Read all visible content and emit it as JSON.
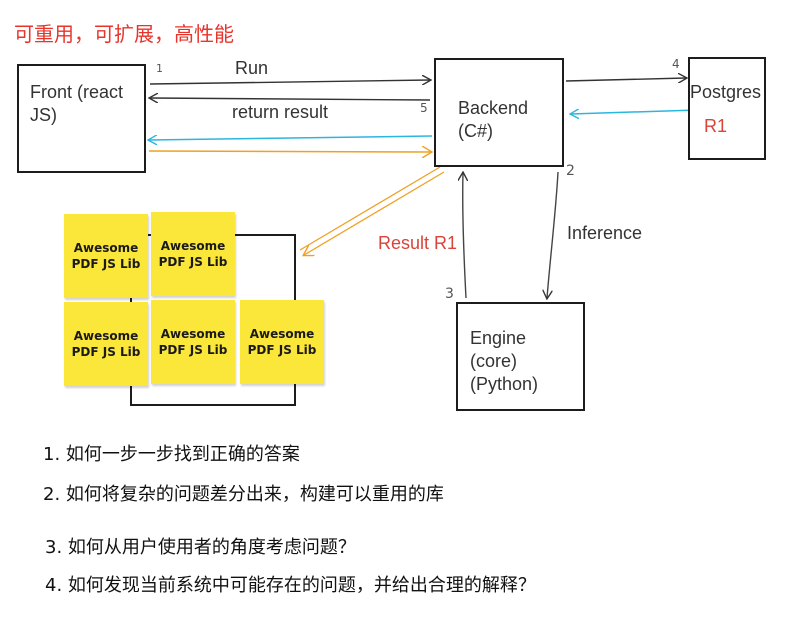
{
  "title": "可重用，可扩展，高性能",
  "nodes": {
    "front": "Front (react\nJS)",
    "backend": "Backend\n(C#)",
    "postgres": "Postgres",
    "postgres_r1": "R1",
    "engine": "Engine\n(core)\n(Python)"
  },
  "edges": {
    "run": "Run",
    "return_result": "return result",
    "inference": "Inference",
    "result_r1": "Result R1"
  },
  "step_marks": {
    "one": "1",
    "two": "2",
    "three": "3",
    "four": "4",
    "five": "5"
  },
  "libs": [
    "Awesome\nPDF JS Lib",
    "Awesome\nPDF JS Lib",
    "Awesome\nPDF JS Lib",
    "Awesome\nPDF JS Lib",
    "Awesome\nPDF JS Lib"
  ],
  "questions": [
    "1. 如何一步一步找到正确的答案",
    "2. 如何将复杂的问题差分出来，构建可以重用的库",
    "3. 如何从用户使用者的角度考虑问题？",
    "4. 如何发现当前系统中可能存在的问题，并给出合理的解释？"
  ],
  "colors": {
    "title": "#e8352c",
    "accent_red": "#d9443a",
    "cyan": "#2bb6e0",
    "orange": "#f0a023",
    "sticky": "#fbe63a"
  }
}
